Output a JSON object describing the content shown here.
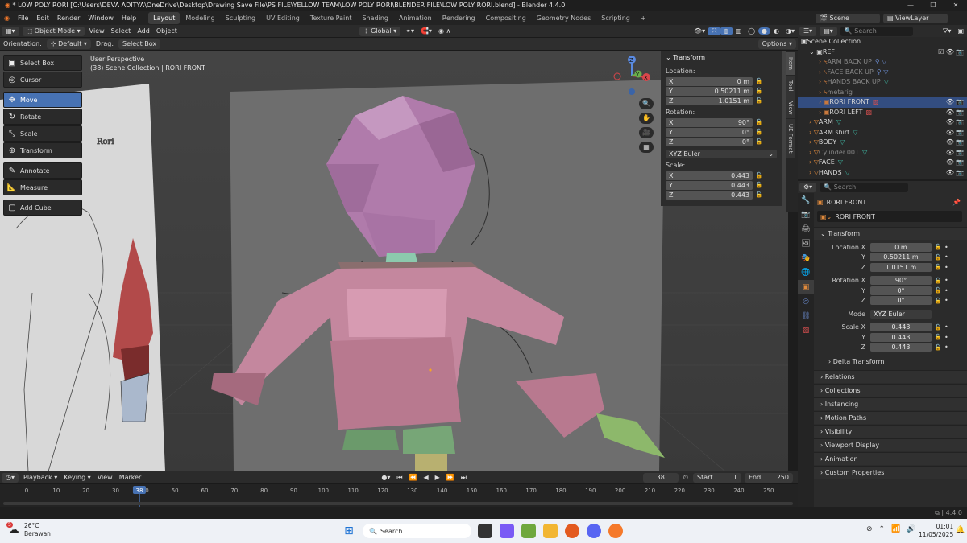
{
  "titlebar": {
    "title": "* LOW POLY RORI [C:\\Users\\DEVA ADITYA\\OneDrive\\Desktop\\Drawing Save File\\PS FILE\\YELLOW TEAM\\LOW POLY RORI\\BLENDER FILE\\LOW POLY RORI.blend] - Blender 4.4.0"
  },
  "menu": {
    "items": [
      "File",
      "Edit",
      "Render",
      "Window",
      "Help"
    ]
  },
  "workspaces": [
    "Layout",
    "Modeling",
    "Sculpting",
    "UV Editing",
    "Texture Paint",
    "Shading",
    "Animation",
    "Rendering",
    "Compositing",
    "Geometry Nodes",
    "Scripting"
  ],
  "topright": {
    "scene": "Scene",
    "viewlayer": "ViewLayer"
  },
  "viewport_header": {
    "mode": "Object Mode",
    "view": "View",
    "select": "Select",
    "add": "Add",
    "object": "Object",
    "global": "Global"
  },
  "tool_settings": {
    "orientation_label": "Orientation:",
    "orientation_value": "Default",
    "drag_label": "Drag:",
    "drag_value": "Select Box",
    "options": "Options"
  },
  "overlay": {
    "line1": "User Perspective",
    "line2": "(38) Scene Collection | RORI FRONT"
  },
  "tools": [
    {
      "label": "Select Box",
      "icon": "▣"
    },
    {
      "label": "Cursor",
      "icon": "◎"
    },
    {
      "label": "Move",
      "icon": "✥"
    },
    {
      "label": "Rotate",
      "icon": "↻"
    },
    {
      "label": "Scale",
      "icon": "⤡"
    },
    {
      "label": "Transform",
      "icon": "⊕"
    },
    {
      "label": "Annotate",
      "icon": "✎"
    },
    {
      "label": "Measure",
      "icon": "📐"
    },
    {
      "label": "Add Cube",
      "icon": "▢"
    }
  ],
  "npanel": {
    "header": "Transform",
    "location_label": "Location:",
    "rotation_label": "Rotation:",
    "scale_label": "Scale:",
    "location": [
      {
        "axis": "X",
        "value": "0 m"
      },
      {
        "axis": "Y",
        "value": "0.50211 m"
      },
      {
        "axis": "Z",
        "value": "1.0151 m"
      }
    ],
    "rotation": [
      {
        "axis": "X",
        "value": "90°"
      },
      {
        "axis": "Y",
        "value": "0°"
      },
      {
        "axis": "Z",
        "value": "0°"
      }
    ],
    "rotation_mode": "XYZ Euler",
    "scale": [
      {
        "axis": "X",
        "value": "0.443"
      },
      {
        "axis": "Y",
        "value": "0.443"
      },
      {
        "axis": "Z",
        "value": "0.443"
      }
    ],
    "tabs": [
      "Item",
      "Tool",
      "View",
      "UE Format"
    ]
  },
  "outliner": {
    "search_placeholder": "Search",
    "root": "Scene Collection",
    "items": [
      {
        "label": "REF",
        "indent": 1,
        "muted": false
      },
      {
        "label": "ARM BACK UP",
        "indent": 2,
        "muted": true
      },
      {
        "label": "FACE BACK UP",
        "indent": 2,
        "muted": true
      },
      {
        "label": "HANDS BACK UP",
        "indent": 2,
        "muted": true
      },
      {
        "label": "metarig",
        "indent": 2,
        "muted": true
      },
      {
        "label": "RORI FRONT",
        "indent": 2,
        "muted": false
      },
      {
        "label": "RORI LEFT",
        "indent": 2,
        "muted": false
      },
      {
        "label": "ARM",
        "indent": 1,
        "muted": false
      },
      {
        "label": "ARM shirt",
        "indent": 1,
        "muted": false
      },
      {
        "label": "BODY",
        "indent": 1,
        "muted": false
      },
      {
        "label": "Cylinder.001",
        "indent": 1,
        "muted": true
      },
      {
        "label": "FACE",
        "indent": 1,
        "muted": false
      },
      {
        "label": "HANDS",
        "indent": 1,
        "muted": false
      }
    ]
  },
  "properties": {
    "search_placeholder": "Search",
    "object_name": "RORI FRONT",
    "data_name": "RORI FRONT",
    "transform_header": "Transform",
    "rows": [
      {
        "label": "Location X",
        "value": "0 m"
      },
      {
        "label": "Y",
        "value": "0.50211 m"
      },
      {
        "label": "Z",
        "value": "1.0151 m"
      },
      {
        "label": "Rotation X",
        "value": "90°"
      },
      {
        "label": "Y",
        "value": "0°"
      },
      {
        "label": "Z",
        "value": "0°"
      },
      {
        "label": "Mode",
        "value": "XYZ Euler"
      },
      {
        "label": "Scale X",
        "value": "0.443"
      },
      {
        "label": "Y",
        "value": "0.443"
      },
      {
        "label": "Z",
        "value": "0.443"
      }
    ],
    "delta": "Delta Transform",
    "sections": [
      "Relations",
      "Collections",
      "Instancing",
      "Motion Paths",
      "Visibility",
      "Viewport Display",
      "Animation",
      "Custom Properties"
    ]
  },
  "timeline": {
    "playback": "Playback",
    "keying": "Keying",
    "view": "View",
    "marker": "Marker",
    "current_frame": "38",
    "start_label": "Start",
    "start": "1",
    "end_label": "End",
    "end": "250",
    "ticks": [
      "0",
      "10",
      "20",
      "30",
      "40",
      "50",
      "60",
      "70",
      "80",
      "90",
      "100",
      "110",
      "120",
      "130",
      "140",
      "150",
      "160",
      "170",
      "180",
      "190",
      "200",
      "210",
      "220",
      "230",
      "240",
      "250"
    ],
    "cursor_frame": 38
  },
  "statusbar": {
    "version": "4.4.0"
  },
  "taskbar": {
    "temp": "26°C",
    "weather": "Berawan",
    "badge": "5",
    "search": "Search",
    "time": "01:01",
    "date": "11/05/2025"
  }
}
